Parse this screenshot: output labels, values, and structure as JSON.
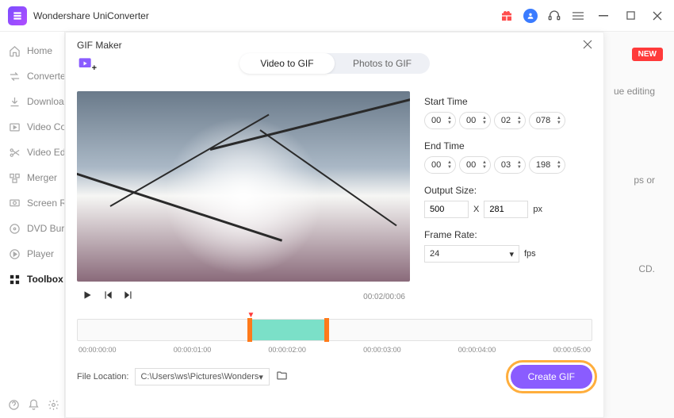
{
  "app": {
    "title": "Wondershare UniConverter"
  },
  "sidebar": {
    "items": [
      {
        "label": "Home"
      },
      {
        "label": "Converter"
      },
      {
        "label": "Downloader"
      },
      {
        "label": "Video Compressor"
      },
      {
        "label": "Video Editor"
      },
      {
        "label": "Merger"
      },
      {
        "label": "Screen Recorder"
      },
      {
        "label": "DVD Burner"
      },
      {
        "label": "Player"
      },
      {
        "label": "Toolbox"
      }
    ]
  },
  "badges": {
    "new": "NEW"
  },
  "background_peeks": {
    "editing": "ue editing",
    "ps": "ps or",
    "cd": "CD."
  },
  "modal": {
    "title": "GIF Maker",
    "tabs": {
      "video": "Video to GIF",
      "photos": "Photos to GIF"
    },
    "player": {
      "current": "00:02",
      "total": "00:06",
      "sep": "/"
    },
    "params": {
      "start_label": "Start Time",
      "end_label": "End Time",
      "start": {
        "h": "00",
        "m": "00",
        "s": "02",
        "ms": "078"
      },
      "end": {
        "h": "00",
        "m": "00",
        "s": "03",
        "ms": "198"
      },
      "output_label": "Output Size:",
      "out_w": "500",
      "out_x": "X",
      "out_h": "281",
      "out_unit": "px",
      "frame_label": "Frame Rate:",
      "fr_value": "24",
      "fr_unit": "fps"
    },
    "timeline_ticks": [
      "00:00:00:00",
      "00:00:01:00",
      "00:00:02:00",
      "00:00:03:00",
      "00:00:04:00",
      "00:00:05:00"
    ],
    "footer": {
      "loc_label": "File Location:",
      "loc_path": "C:\\Users\\ws\\Pictures\\Wonders",
      "create": "Create GIF"
    }
  }
}
